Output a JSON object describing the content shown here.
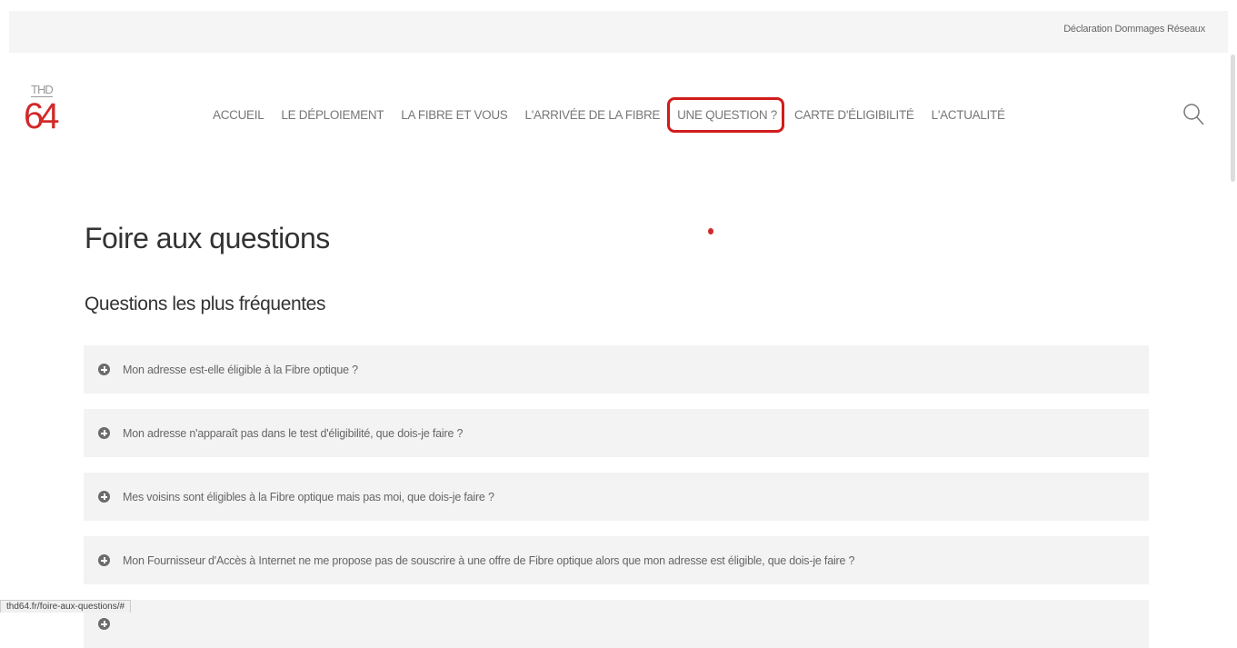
{
  "header": {
    "top_link": "Déclaration Dommages Réseaux",
    "logo": {
      "top": "THD",
      "number": "64"
    },
    "nav": [
      {
        "label": "ACCUEIL",
        "highlighted": false
      },
      {
        "label": "LE DÉPLOIEMENT",
        "highlighted": false
      },
      {
        "label": "LA FIBRE ET VOUS",
        "highlighted": false
      },
      {
        "label": "L'ARRIVÉE DE LA FIBRE",
        "highlighted": false
      },
      {
        "label": "UNE QUESTION ?",
        "highlighted": true
      },
      {
        "label": "CARTE D'ÉLIGIBILITÉ",
        "highlighted": false
      },
      {
        "label": "L'ACTUALITÉ",
        "highlighted": false
      }
    ],
    "search_icon": "search-icon"
  },
  "main": {
    "title": "Foire aux questions",
    "subtitle": "Questions les plus fréquentes",
    "faq": [
      {
        "question": "Mon adresse est-elle éligible à la Fibre optique ?"
      },
      {
        "question": "Mon adresse n'apparaît pas dans le test d'éligibilité, que dois-je faire ?"
      },
      {
        "question": "Mes voisins sont éligibles à la Fibre optique mais pas moi, que dois-je faire ?"
      },
      {
        "question": "Mon Fournisseur d'Accès à Internet ne me propose pas de souscrire à une offre de Fibre optique alors que mon adresse est éligible, que dois-je faire ?"
      },
      {
        "question": ""
      }
    ]
  },
  "status_url": "thd64.fr/foire-aux-questions/#",
  "colors": {
    "accent": "#d12a2a",
    "highlight_border": "#d11c1c"
  }
}
